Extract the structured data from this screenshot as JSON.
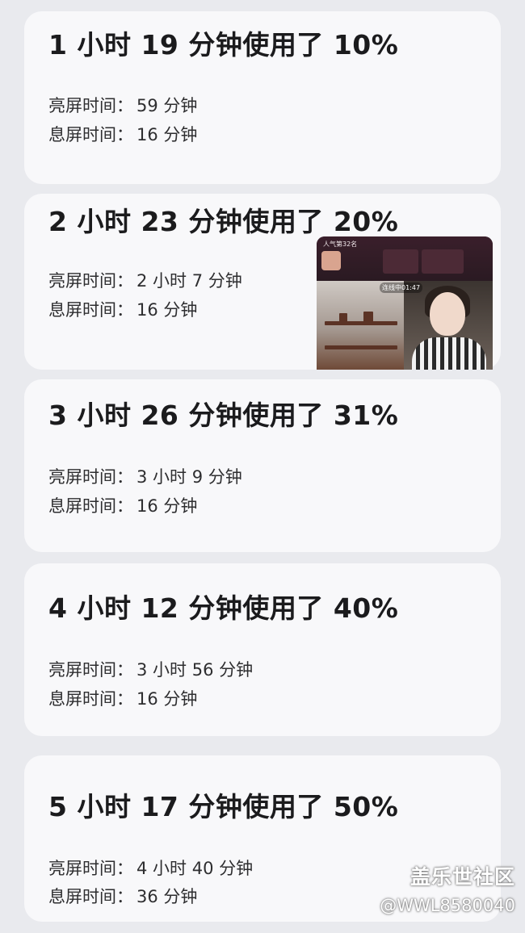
{
  "cards": [
    {
      "title": "1 小时 19 分钟使用了 10%",
      "screen_on_label": "亮屏时间：",
      "screen_on_value": "59 分钟",
      "screen_off_label": "息屏时间：",
      "screen_off_value": "16 分钟"
    },
    {
      "title": "2 小时 23 分钟使用了 20%",
      "screen_on_label": "亮屏时间：",
      "screen_on_value": "2 小时 7 分钟",
      "screen_off_label": "息屏时间：",
      "screen_off_value": "16 分钟"
    },
    {
      "title": "3 小时 26 分钟使用了 31%",
      "screen_on_label": "亮屏时间：",
      "screen_on_value": "3 小时 9 分钟",
      "screen_off_label": "息屏时间：",
      "screen_off_value": "16 分钟"
    },
    {
      "title": "4 小时 12 分钟使用了 40%",
      "screen_on_label": "亮屏时间：",
      "screen_on_value": "3 小时 56 分钟",
      "screen_off_label": "息屏时间：",
      "screen_off_value": "16 分钟"
    },
    {
      "title": "5 小时 17 分钟使用了 50%",
      "screen_on_label": "亮屏时间：",
      "screen_on_value": "4 小时 40 分钟",
      "screen_off_label": "息屏时间：",
      "screen_off_value": "36 分钟"
    }
  ],
  "live_overlay": {
    "rank_text": "人气第32名",
    "timer_text": "连线中01:47"
  },
  "watermark": {
    "name": "盖乐世社区",
    "handle": "@WWL8580040"
  }
}
